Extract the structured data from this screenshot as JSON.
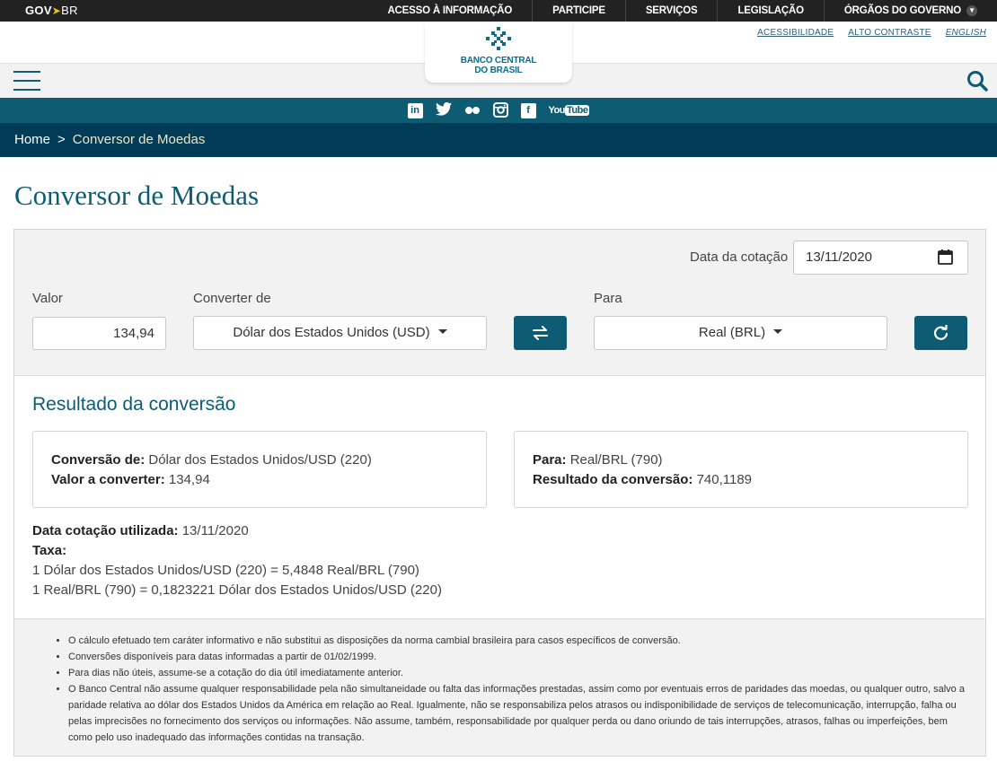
{
  "govbar": {
    "logo_gov": "GOV",
    "logo_br": "BR",
    "links": [
      "ACESSO À INFORMAÇÃO",
      "PARTICIPE",
      "SERVIÇOS",
      "LEGISLAÇÃO",
      "ÓRGÃOS DO GOVERNO"
    ]
  },
  "header": {
    "accessibility": "ACESSIBILIDADE",
    "contrast": "ALTO CONTRASTE",
    "english": "ENGLISH",
    "logo_line1": "BANCO CENTRAL",
    "logo_line2": "DO BRASIL"
  },
  "social": {
    "icons": [
      "linkedin-icon",
      "twitter-icon",
      "flickr-icon",
      "instagram-icon",
      "facebook-icon",
      "youtube-icon"
    ]
  },
  "breadcrumb": {
    "home": "Home",
    "separator": ">",
    "current": "Conversor de Moedas"
  },
  "page": {
    "title": "Conversor de Moedas"
  },
  "form": {
    "date_label": "Data da cotação",
    "date_value": "13/11/2020",
    "valor_label": "Valor",
    "valor_value": "134,94",
    "from_label": "Converter de",
    "from_value": "Dólar dos Estados Unidos (USD)",
    "to_label": "Para",
    "to_value": "Real (BRL)"
  },
  "result": {
    "title": "Resultado da conversão",
    "from_key": "Conversão de:",
    "from_val": "Dólar dos Estados Unidos/USD (220)",
    "amount_key": "Valor a converter:",
    "amount_val": "134,94",
    "to_key": "Para:",
    "to_val": "Real/BRL (790)",
    "result_key": "Resultado da conversão:",
    "result_val": "740,1189",
    "date_key": "Data cotação utilizada:",
    "date_val": "13/11/2020",
    "rate_key": "Taxa:",
    "rate_line1": "1 Dólar dos Estados Unidos/USD (220) = 5,4848 Real/BRL (790)",
    "rate_line2": "1 Real/BRL (790) = 0,1823221 Dólar dos Estados Unidos/USD (220)"
  },
  "notes": [
    "O cálculo efetuado tem caráter informativo e não substitui as disposições da norma cambial brasileira para casos específicos de conversão.",
    "Conversões disponíveis para datas informadas a partir de 01/02/1999.",
    "Para dias não úteis, assume-se a cotação do dia útil imediatamente anterior.",
    "O Banco Central não assume qualquer responsabilidade pela não simultaneidade ou falta das informações prestadas, assim como por eventuais erros de paridades das moedas, ou qualquer outro, salvo a paridade relativa ao dólar dos Estados Unidos da América em relação ao Real. Igualmente, não se responsabiliza pelos atrasos ou indisponibilidade de serviços de telecomunicação, interrupção, falha ou pelas imprecisões no fornecimento dos serviços ou informações. Não assume, também, responsabilidade por qualquer perda ou dano oriundo de tais interrupções, atrasos, falhas ou imperfeições, bem como pelo uso inadequado das informações contidas na transação."
  ],
  "colors": {
    "brand": "#0d5c73",
    "breadcrumb_bg": "#003b57",
    "govbar_bg": "#222222"
  }
}
